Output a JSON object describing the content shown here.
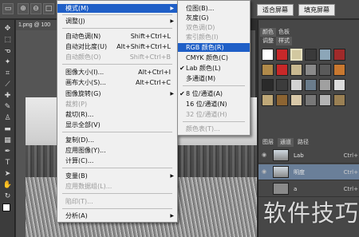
{
  "optbar": {
    "zoom_in_icon": "zoom-in-icon",
    "zoom_out_icon": "zoom-out-icon",
    "fit_screen": "适合屏幕",
    "fill_screen": "填充屏幕"
  },
  "document": {
    "tab_label": "1.png @ 100"
  },
  "image_menu": {
    "items": [
      {
        "label": "模式(M)",
        "shortcut": "",
        "submenu": true,
        "state": "highlighted"
      },
      {
        "label": "调整(J)",
        "shortcut": "",
        "submenu": true,
        "state": "normal"
      },
      {
        "label": "自动色调(N)",
        "shortcut": "Shift+Ctrl+L",
        "submenu": false,
        "state": "normal"
      },
      {
        "label": "自动对比度(U)",
        "shortcut": "Alt+Shift+Ctrl+L",
        "submenu": false,
        "state": "normal"
      },
      {
        "label": "自动颜色(O)",
        "shortcut": "Shift+Ctrl+B",
        "submenu": false,
        "state": "disabled"
      },
      {
        "label": "图像大小(I)...",
        "shortcut": "Alt+Ctrl+I",
        "submenu": false,
        "state": "normal"
      },
      {
        "label": "画布大小(S)...",
        "shortcut": "Alt+Ctrl+C",
        "submenu": false,
        "state": "normal"
      },
      {
        "label": "图像旋转(G)",
        "shortcut": "",
        "submenu": true,
        "state": "normal"
      },
      {
        "label": "裁剪(P)",
        "shortcut": "",
        "submenu": false,
        "state": "disabled"
      },
      {
        "label": "裁切(R)...",
        "shortcut": "",
        "submenu": false,
        "state": "normal"
      },
      {
        "label": "显示全部(V)",
        "shortcut": "",
        "submenu": false,
        "state": "normal"
      },
      {
        "label": "复制(D)...",
        "shortcut": "",
        "submenu": false,
        "state": "normal"
      },
      {
        "label": "应用图像(Y)...",
        "shortcut": "",
        "submenu": false,
        "state": "normal"
      },
      {
        "label": "计算(C)...",
        "shortcut": "",
        "submenu": false,
        "state": "normal"
      },
      {
        "label": "变量(B)",
        "shortcut": "",
        "submenu": true,
        "state": "normal"
      },
      {
        "label": "应用数据组(L)...",
        "shortcut": "",
        "submenu": false,
        "state": "disabled"
      },
      {
        "label": "陷印(T)...",
        "shortcut": "",
        "submenu": false,
        "state": "disabled"
      },
      {
        "label": "分析(A)",
        "shortcut": "",
        "submenu": true,
        "state": "normal"
      }
    ]
  },
  "mode_submenu": {
    "items": [
      {
        "label": "位图(B)...",
        "checked": false,
        "state": "normal"
      },
      {
        "label": "灰度(G)",
        "checked": false,
        "state": "normal"
      },
      {
        "label": "双色调(D)",
        "checked": false,
        "state": "disabled"
      },
      {
        "label": "索引颜色(I)",
        "checked": false,
        "state": "disabled"
      },
      {
        "label": "RGB 颜色(R)",
        "checked": false,
        "state": "highlighted"
      },
      {
        "label": "CMYK 颜色(C)",
        "checked": false,
        "state": "normal"
      },
      {
        "label": "Lab 颜色(L)",
        "checked": true,
        "state": "normal"
      },
      {
        "label": "多通道(M)",
        "checked": false,
        "state": "normal"
      },
      {
        "label": "8 位/通道(A)",
        "checked": true,
        "state": "normal"
      },
      {
        "label": "16 位/通道(N)",
        "checked": false,
        "state": "normal"
      },
      {
        "label": "32 位/通道(H)",
        "checked": false,
        "state": "disabled"
      },
      {
        "label": "颜色表(T)...",
        "checked": false,
        "state": "disabled"
      }
    ]
  },
  "right_panel": {
    "color_tabs": [
      "颜色",
      "色板"
    ],
    "style_tabs": [
      "调整",
      "样式"
    ],
    "layer_tabs": [
      "图层",
      "通道",
      "路径"
    ],
    "channels": [
      {
        "name": "Lab",
        "shortcut": "Ctrl+"
      },
      {
        "name": "明度",
        "shortcut": "Ctrl+"
      },
      {
        "name": "a",
        "shortcut": "Ctrl+"
      }
    ]
  },
  "watermark": "软件技巧",
  "colors": {
    "highlight": "#1f5fc7",
    "menu_bg": "#f0f0f0",
    "panel_bg": "#474747"
  }
}
